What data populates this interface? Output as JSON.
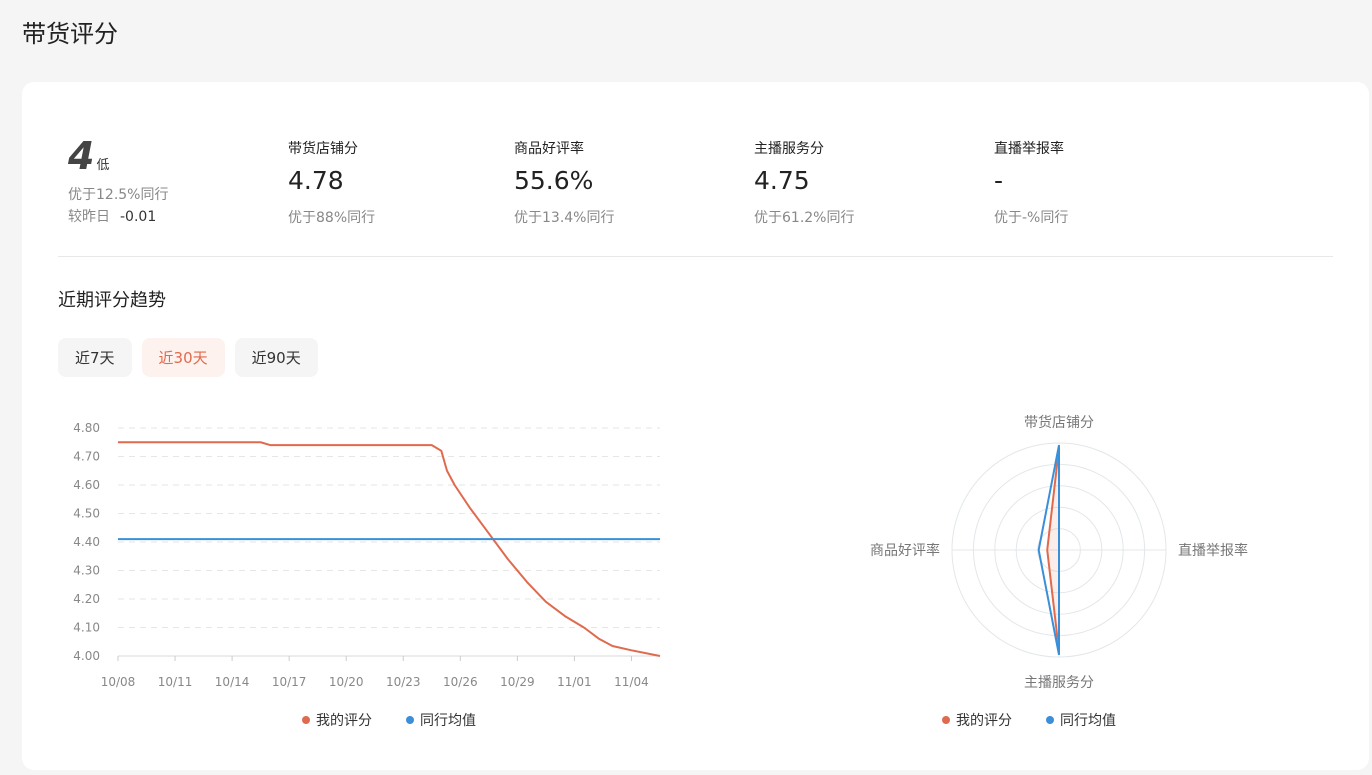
{
  "page": {
    "title": "带货评分"
  },
  "summary": {
    "score": "4",
    "level": "低",
    "better_than": "优于12.5%同行",
    "vs_yesterday_label": "较昨日",
    "vs_yesterday_value": "-0.01"
  },
  "metrics": [
    {
      "label": "带货店铺分",
      "value": "4.78",
      "sub": "优于88%同行"
    },
    {
      "label": "商品好评率",
      "value": "55.6%",
      "sub": "优于13.4%同行"
    },
    {
      "label": "主播服务分",
      "value": "4.75",
      "sub": "优于61.2%同行"
    },
    {
      "label": "直播举报率",
      "value": "-",
      "sub": "优于-%同行"
    }
  ],
  "trend": {
    "title": "近期评分趋势",
    "tabs": [
      "近7天",
      "近30天",
      "近90天"
    ],
    "active_tab": 1
  },
  "colors": {
    "mine": "#e06a4e",
    "peer": "#3a8fd9",
    "accent": "#e06a4e"
  },
  "chart_data": [
    {
      "type": "line",
      "title": "",
      "xlabel": "",
      "ylabel": "",
      "x_ticks": [
        "10/08",
        "10/11",
        "10/14",
        "10/17",
        "10/20",
        "10/23",
        "10/26",
        "10/29",
        "11/01",
        "11/04"
      ],
      "y_ticks": [
        "4.80",
        "4.70",
        "4.60",
        "4.50",
        "4.40",
        "4.30",
        "4.20",
        "4.10",
        "4.00"
      ],
      "ylim": [
        4.0,
        4.8
      ],
      "x_range": [
        0,
        28.5
      ],
      "series": [
        {
          "name": "我的评分",
          "points": [
            [
              0,
              4.75
            ],
            [
              7.5,
              4.75
            ],
            [
              8,
              4.74
            ],
            [
              16.5,
              4.74
            ],
            [
              17,
              4.72
            ],
            [
              17.3,
              4.65
            ],
            [
              17.7,
              4.6
            ],
            [
              18.5,
              4.52
            ],
            [
              19.5,
              4.43
            ],
            [
              20.5,
              4.34
            ],
            [
              21.5,
              4.26
            ],
            [
              22.5,
              4.19
            ],
            [
              23.5,
              4.14
            ],
            [
              24.5,
              4.1
            ],
            [
              25.3,
              4.06
            ],
            [
              26,
              4.035
            ],
            [
              27,
              4.02
            ],
            [
              28.5,
              4.0
            ]
          ]
        },
        {
          "name": "同行均值",
          "points": [
            [
              0,
              4.41
            ],
            [
              28.5,
              4.41
            ]
          ]
        }
      ],
      "legend_position": "bottom",
      "grid": true
    },
    {
      "type": "radar",
      "axes": [
        "带货店铺分",
        "直播举报率",
        "主播服务分",
        "商品好评率"
      ],
      "max": 5,
      "series": [
        {
          "name": "我的评分",
          "values": [
            4.78,
            0,
            4.75,
            0.55
          ]
        },
        {
          "name": "同行均值",
          "values": [
            4.9,
            0,
            4.9,
            0.95
          ]
        }
      ],
      "legend_position": "bottom"
    }
  ]
}
